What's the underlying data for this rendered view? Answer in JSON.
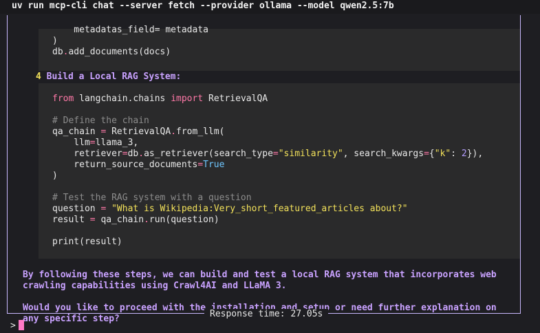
{
  "titlebar": {
    "command": "uv run mcp-cli chat --server fetch --provider ollama --model qwen2.5:7b"
  },
  "code_block_1": {
    "lines": [
      {
        "parts": [
          "    metadatas_field= metadata"
        ]
      },
      {
        "parts": [
          ")"
        ]
      },
      {
        "parts": [
          "db",
          ".",
          "add_documents(docs)"
        ]
      }
    ]
  },
  "step": {
    "number": "4",
    "label": "Build a Local RAG System:"
  },
  "code_block_2": {
    "line1": [
      "from",
      " langchain.chains ",
      "import",
      " RetrievalQA"
    ],
    "line2": [
      "# Define the chain"
    ],
    "line3": [
      "qa_chain ",
      "=",
      " RetrievalQA",
      ".",
      "from_llm("
    ],
    "line4": [
      "    llm",
      "=",
      "llama_3,"
    ],
    "line5": [
      "    retriever",
      "=",
      "db",
      ".",
      "as_retriever(search_type",
      "=",
      "\"similarity\"",
      ", search_kwargs",
      "=",
      "{",
      "\"k\"",
      ": ",
      "2",
      "}),"
    ],
    "line6": [
      "    return_source_documents",
      "=",
      "True"
    ],
    "line7": [
      ")"
    ],
    "line8": [
      "# Test the RAG system with a question"
    ],
    "line9": [
      "question ",
      "=",
      " \"What is Wikipedia:Very_short_featured_articles about?\""
    ],
    "line10": [
      "result ",
      "=",
      " qa_chain",
      ".",
      "run(question)"
    ],
    "line11": [
      "print(result)"
    ]
  },
  "paragraphs": {
    "p1": "By following these steps, we can build and test a local RAG system that incorporates web crawling capabilities using Crawl4AI and LLaMA 3.",
    "p2": "Would you like to proceed with the installation and setup or need further explanation on any specific step?"
  },
  "footer": {
    "response_time": "Response time: 27.05s"
  },
  "prompt": {
    "symbol": ">"
  },
  "colors": {
    "border": "#c9b9ff",
    "prose": "#c9a2ff",
    "keyword": "#ff79a8",
    "string": "#f1e05a",
    "number": "#b39dff",
    "constant": "#6fc7ff",
    "cursor": "#ff79c6"
  }
}
